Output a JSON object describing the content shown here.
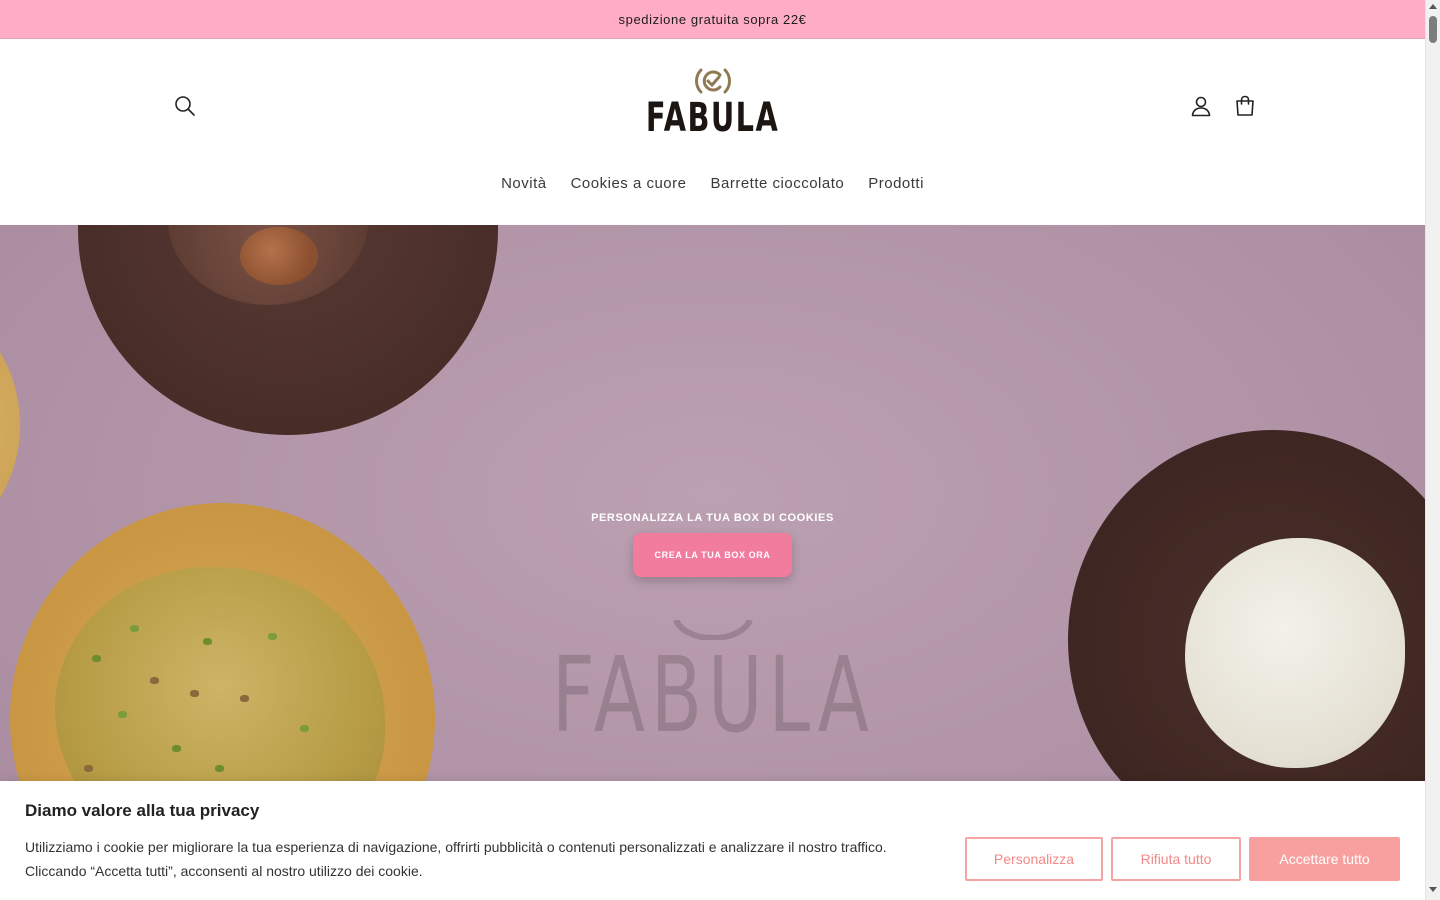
{
  "announcement": {
    "text": "spedizione gratuita sopra 22€"
  },
  "header": {
    "logo_text": "FABULA",
    "icons": {
      "search": "search-icon",
      "account": "user-icon",
      "cart": "cart-icon"
    }
  },
  "nav": {
    "items": [
      {
        "label": "Novità"
      },
      {
        "label": "Cookies a cuore"
      },
      {
        "label": "Barrette cioccolato"
      },
      {
        "label": "Prodotti"
      }
    ]
  },
  "hero": {
    "heading": "PERSONALIZZA  LA TUA BOX DI COOKIES",
    "cta_label": "CREA LA TUA BOX ORA",
    "watermark_text": "FABULA",
    "colors": {
      "cta": "#f27c9e",
      "background": "#b394a8"
    }
  },
  "cookie_banner": {
    "title": "Diamo valore alla tua privacy",
    "text": "Utilizziamo i cookie per migliorare la tua esperienza di navigazione, offrirti pubblicità o contenuti personalizzati e analizzare il nostro traffico. Cliccando “Accetta tutti”, acconsenti al nostro utilizzo dei cookie.",
    "buttons": {
      "customize": "Personalizza",
      "reject": "Rifiuta tutto",
      "accept": "Accettare tutto"
    },
    "colors": {
      "accent": "#f8a09f"
    }
  },
  "colors": {
    "announcement_bg": "#ffadc4"
  }
}
